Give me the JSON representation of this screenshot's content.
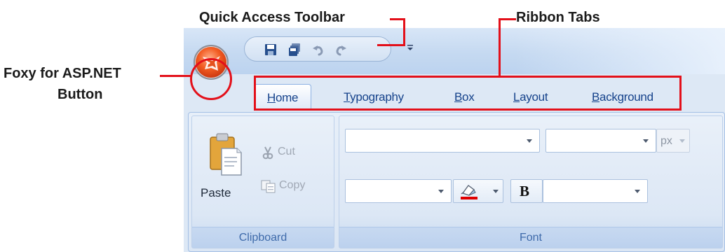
{
  "annotations": {
    "qat_label": "Quick Access Toolbar",
    "tabs_label": "Ribbon Tabs",
    "orb_label_line1": "Foxy for ASP.NET",
    "orb_label_line2": "Button",
    "highlight_color": "#e3101a"
  },
  "qat": {
    "icons": [
      "save-icon",
      "save-all-icon",
      "undo-icon",
      "redo-icon"
    ],
    "more_glyph": "="
  },
  "orb": {
    "icon": "fox-logo-icon"
  },
  "tabs": [
    {
      "key": "H",
      "rest": "ome",
      "active": true
    },
    {
      "key": "T",
      "rest": "ypography",
      "active": false
    },
    {
      "key": "B",
      "rest": "ox",
      "active": false
    },
    {
      "key": "L",
      "rest": "ayout",
      "active": false
    },
    {
      "key": "B",
      "rest": "ackground",
      "active": false
    }
  ],
  "clipboard": {
    "caption": "Clipboard",
    "paste_label": "Paste",
    "cut_label": "Cut",
    "copy_label": "Copy"
  },
  "font": {
    "caption": "Font",
    "unit_value": "px",
    "bold_glyph": "B",
    "highlight_underline_color": "#e00000"
  }
}
